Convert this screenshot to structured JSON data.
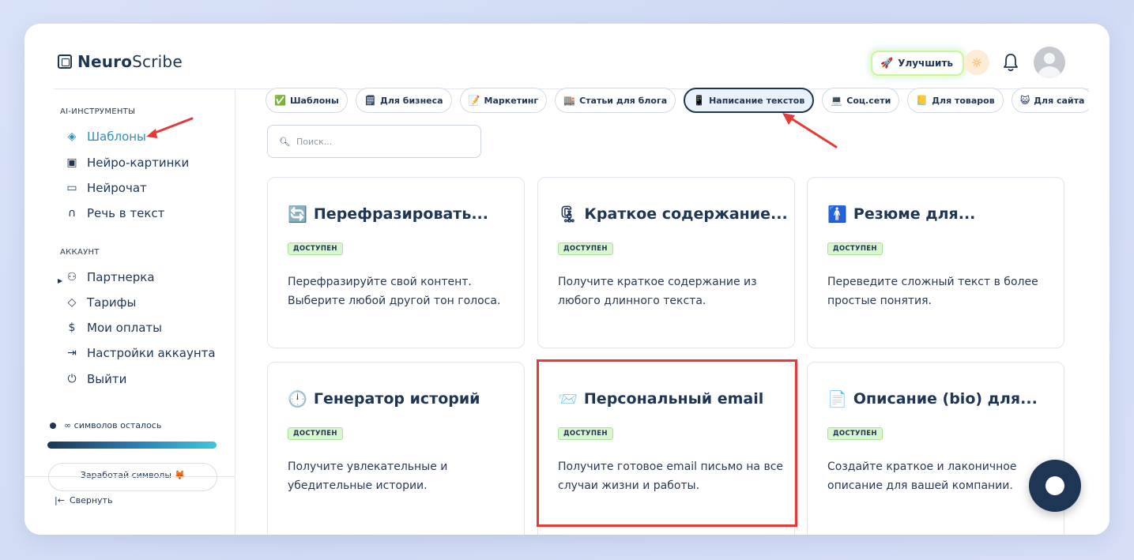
{
  "header": {
    "logo_bold": "Neuro",
    "logo_rest": "Scribe",
    "upgrade_label": "Улучшить"
  },
  "sidebar": {
    "section_tools": "AI-ИНСТРУМЕНТЫ",
    "tools": [
      {
        "label": "Шаблоны",
        "icon": "layers-icon",
        "active": true
      },
      {
        "label": "Нейро-картинки",
        "icon": "image-icon"
      },
      {
        "label": "Нейрочат",
        "icon": "chat-icon"
      },
      {
        "label": "Речь в текст",
        "icon": "headphones-icon"
      }
    ],
    "section_account": "АККАУНТ",
    "account": [
      {
        "label": "Партнерка",
        "icon": "users-icon"
      },
      {
        "label": "Тарифы",
        "icon": "tag-icon"
      },
      {
        "label": "Мои оплаты",
        "icon": "dollar-icon"
      },
      {
        "label": "Настройки аккаунта",
        "icon": "logout-arrow-icon"
      },
      {
        "label": "Выйти",
        "icon": "power-icon"
      }
    ],
    "chars_left": "∞ символов осталось",
    "earn_label": "Заработай символы 🦊",
    "collapse_label": "Свернуть"
  },
  "chips": [
    {
      "label": "Шаблоны",
      "icon": "✅"
    },
    {
      "label": "Для бизнеса",
      "icon": "🗒"
    },
    {
      "label": "Маркетинг",
      "icon": "📝"
    },
    {
      "label": "Статьи для блога",
      "icon": "🏬"
    },
    {
      "label": "Написание текстов",
      "icon": "📱",
      "active": true
    },
    {
      "label": "Соц.сети",
      "icon": "💻"
    },
    {
      "label": "Для товаров",
      "icon": "📒"
    },
    {
      "label": "Для сайта",
      "icon": "😺"
    }
  ],
  "search": {
    "placeholder": "Поиск..."
  },
  "badge_text": "ДОСТУПЕН",
  "cards": [
    {
      "title": "Перефразировать...",
      "icon": "🔄",
      "desc": "Перефразируйте свой контент. Выберите любой другой тон голоса."
    },
    {
      "title": "Краткое содержание...",
      "icon": "🗜",
      "desc": "Получите краткое содержание из любого длинного текста."
    },
    {
      "title": "Резюме для...",
      "icon": "🚹",
      "desc": "Переведите сложный текст в более простые понятия."
    },
    {
      "title": "Генератор историй",
      "icon": "🕛",
      "desc": "Получите увлекательные и убедительные истории."
    },
    {
      "title": "Персональный email",
      "icon": "📨",
      "desc": "Получите готовое email письмо на все случаи жизни и работы."
    },
    {
      "title": "Описание (bio) для...",
      "icon": "📄",
      "desc": "Создайте краткое и лаконичное описание для вашей компании."
    }
  ],
  "colors": {
    "primary": "#1e3553",
    "accent": "#2e8fb8",
    "annotation": "#e53a3a",
    "badge_bg": "#d9f6d1"
  }
}
